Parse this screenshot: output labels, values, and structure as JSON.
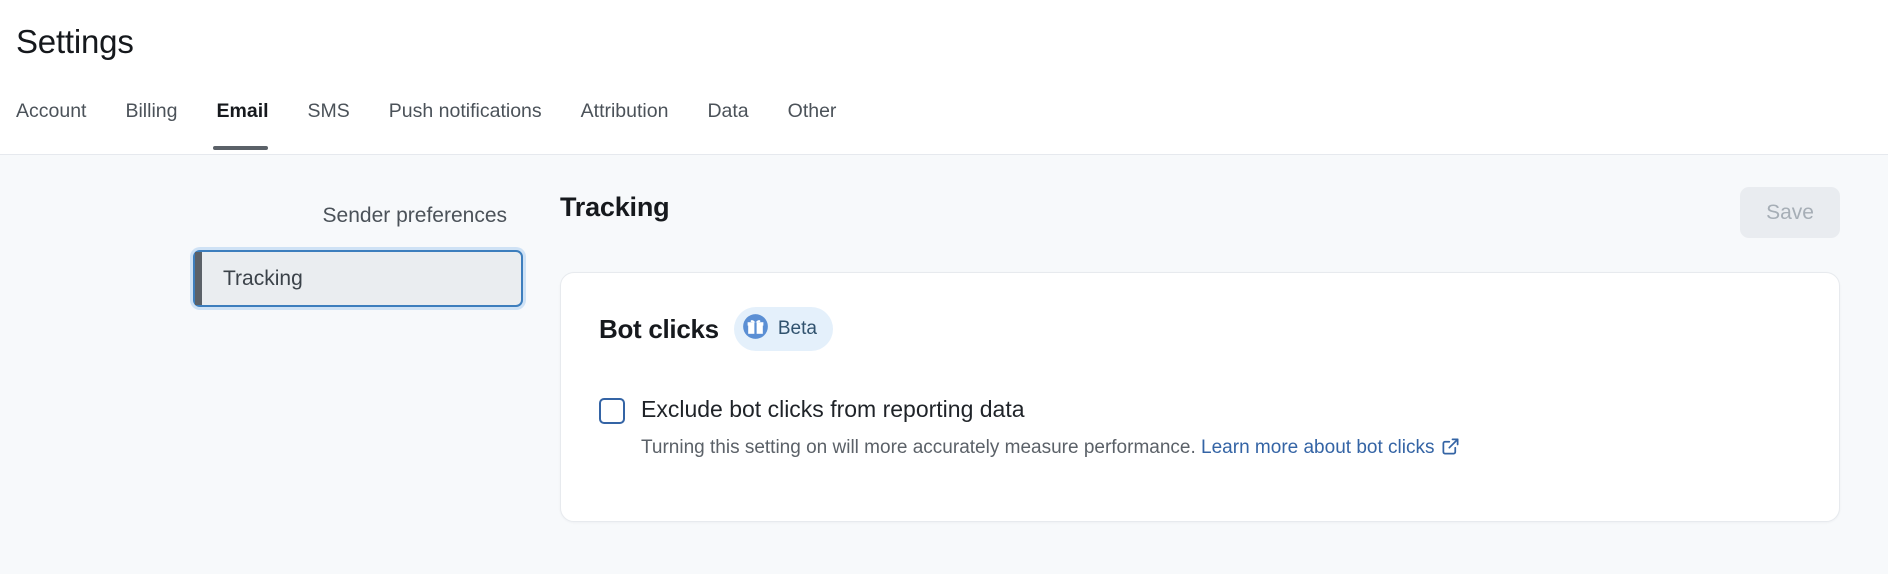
{
  "header": {
    "title": "Settings",
    "tabs": [
      {
        "label": "Account",
        "active": false
      },
      {
        "label": "Billing",
        "active": false
      },
      {
        "label": "Email",
        "active": true
      },
      {
        "label": "SMS",
        "active": false
      },
      {
        "label": "Push notifications",
        "active": false
      },
      {
        "label": "Attribution",
        "active": false
      },
      {
        "label": "Data",
        "active": false
      },
      {
        "label": "Other",
        "active": false
      }
    ]
  },
  "sidebar": {
    "items": [
      {
        "label": "Sender preferences",
        "selected": false
      },
      {
        "label": "Tracking",
        "selected": true
      }
    ]
  },
  "main": {
    "section_title": "Tracking",
    "save_label": "Save",
    "save_disabled": true,
    "card": {
      "title": "Bot clicks",
      "badge": {
        "label": "Beta",
        "icon": "gift-icon"
      },
      "checkbox": {
        "label": "Exclude bot clicks from reporting data",
        "checked": false,
        "help_text": "Turning this setting on will more accurately measure performance.",
        "link_text": "Learn more about bot clicks",
        "link_icon": "external-link-icon"
      }
    }
  },
  "colors": {
    "page_bg": "#f7f9fb",
    "card_bg": "#ffffff",
    "accent_blue": "#3464a5",
    "badge_bg": "#e4f0fb",
    "focus_ring": "#cfe2f5",
    "active_tab_underline": "#5b6168",
    "disabled_btn_bg": "#e9ecf0",
    "disabled_btn_text": "#a6aeb6"
  }
}
